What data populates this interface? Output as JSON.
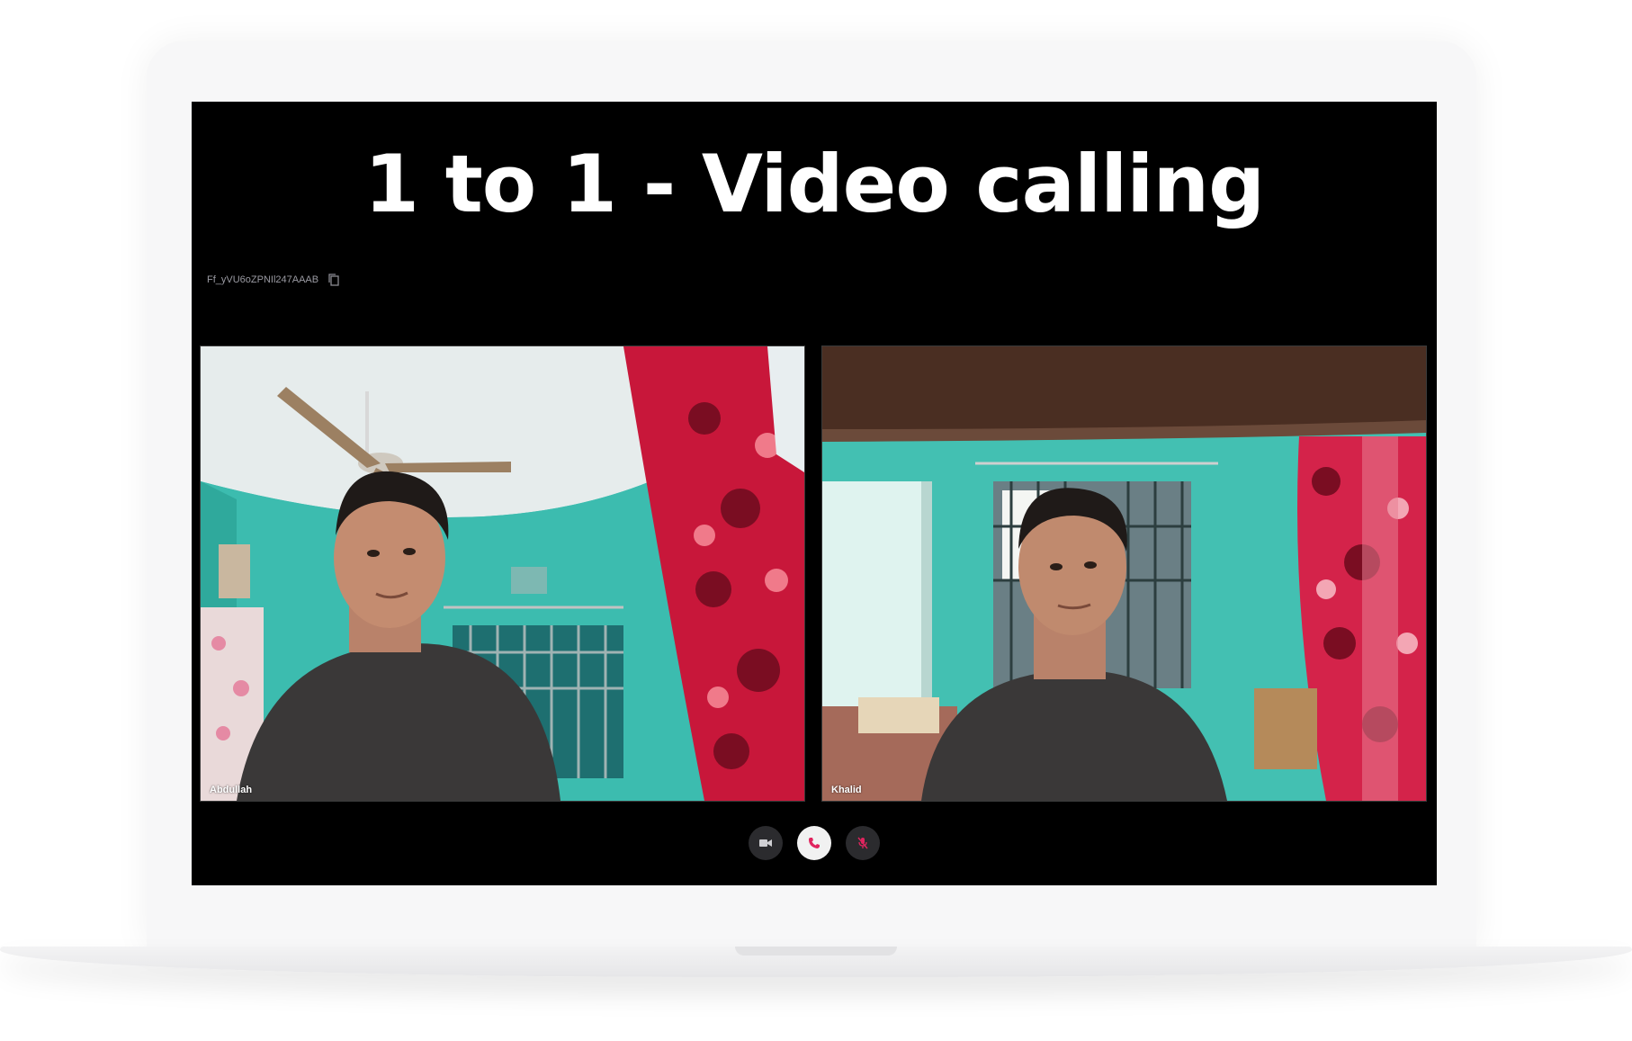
{
  "headline": "1 to 1 - Video calling",
  "room": {
    "id": "Ff_yVU6oZPNIl247AAAB",
    "copy_icon": "copy-icon"
  },
  "participants": [
    {
      "name": "Abdullah"
    },
    {
      "name": "Khalid"
    }
  ],
  "controls": {
    "camera_icon": "video-camera-icon",
    "end_call_icon": "phone-icon",
    "mic_icon": "mic-off-icon"
  },
  "colors": {
    "screen_bg": "#000000",
    "accent": "#e0245e",
    "wall": "#3fbdb0",
    "curtain": "#c8173a"
  }
}
